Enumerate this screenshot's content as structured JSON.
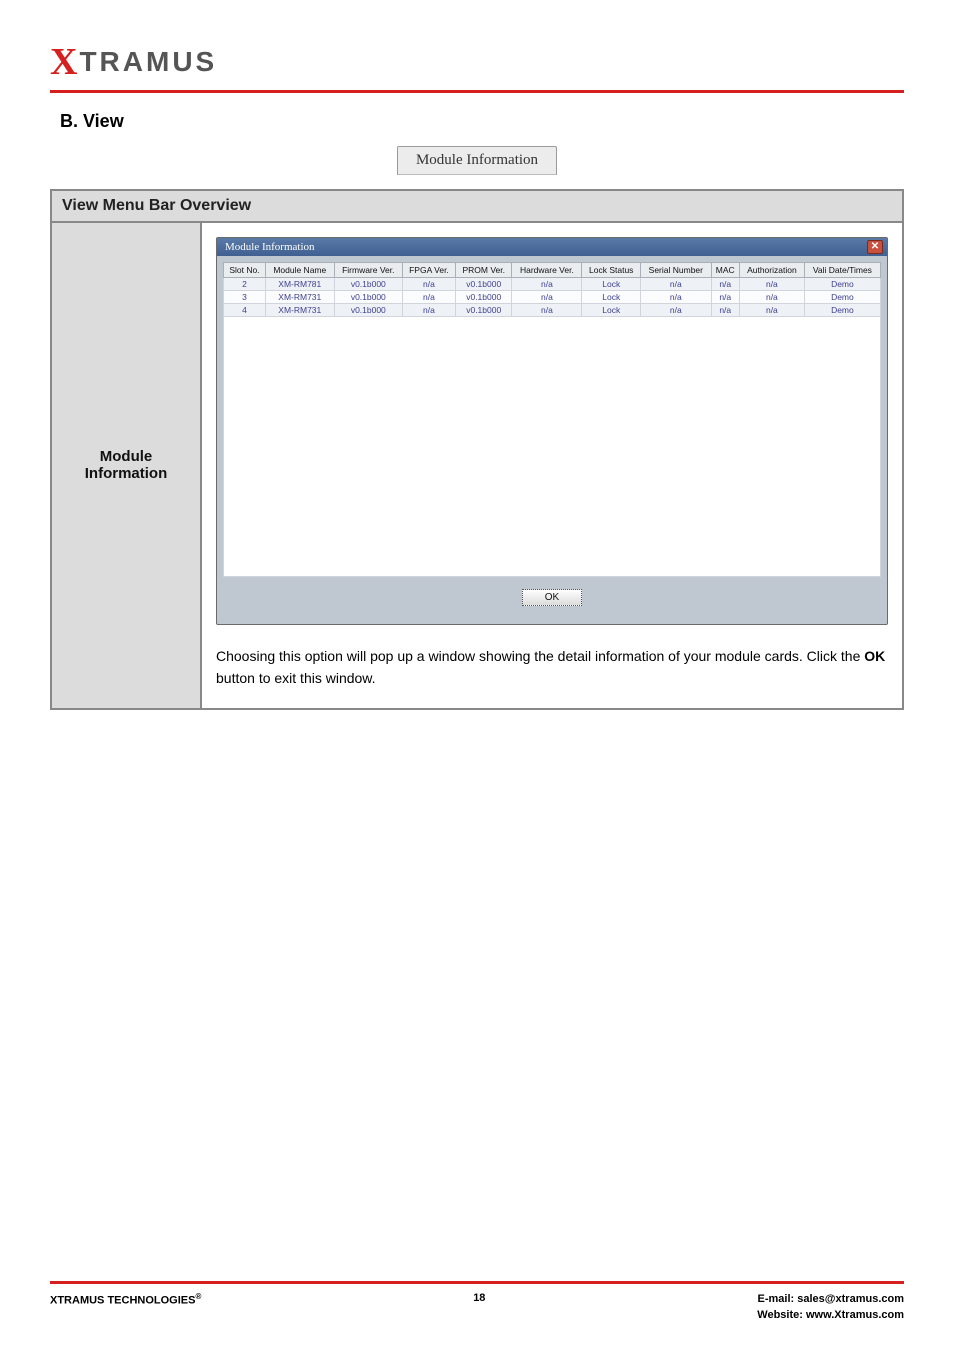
{
  "logo": {
    "x": "X",
    "rest": "TRAMUS"
  },
  "section_title": "B. View",
  "tab_label": "Module Information",
  "overview_title": "View Menu Bar Overview",
  "sidebar_label": "Module\nInformation",
  "mod_window": {
    "title": "Module Information",
    "close_glyph": "✕",
    "ok_label": "OK",
    "headers": [
      "Slot No.",
      "Module Name",
      "Firmware Ver.",
      "FPGA Ver.",
      "PROM Ver.",
      "Hardware Ver.",
      "Lock Status",
      "Serial Number",
      "MAC",
      "Authorization",
      "Vali Date/Times"
    ],
    "rows": [
      [
        "2",
        "XM-RM781",
        "v0.1b000",
        "n/a",
        "v0.1b000",
        "n/a",
        "Lock",
        "n/a",
        "n/a",
        "n/a",
        "Demo"
      ],
      [
        "3",
        "XM-RM731",
        "v0.1b000",
        "n/a",
        "v0.1b000",
        "n/a",
        "Lock",
        "n/a",
        "n/a",
        "n/a",
        "Demo"
      ],
      [
        "4",
        "XM-RM731",
        "v0.1b000",
        "n/a",
        "v0.1b000",
        "n/a",
        "Lock",
        "n/a",
        "n/a",
        "n/a",
        "Demo"
      ]
    ]
  },
  "description_1": "Choosing this option will pop up a window showing the detail information of your module cards. Click the ",
  "description_bold": "OK",
  "description_2": " button to exit this window.",
  "footer": {
    "left": "XTRAMUS TECHNOLOGIES",
    "reg": "®",
    "page": "18",
    "email_label": "E-mail: ",
    "email": "sales@xtramus.com",
    "web_label": "Website:  ",
    "web": "www.Xtramus.com"
  }
}
